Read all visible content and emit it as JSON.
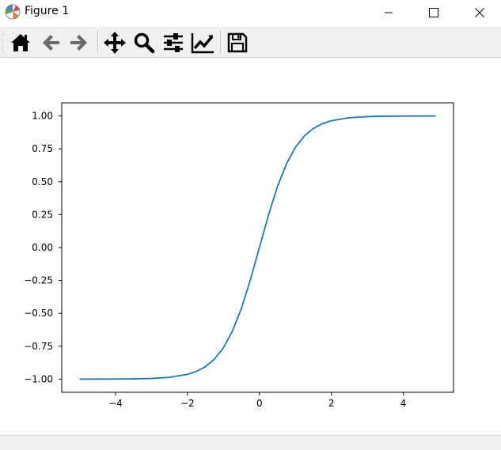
{
  "window": {
    "title": "Figure 1"
  },
  "toolbar": {
    "buttons": [
      {
        "name": "home",
        "icon": "home-icon"
      },
      {
        "name": "back",
        "icon": "arrow-left-icon"
      },
      {
        "name": "forward",
        "icon": "arrow-right-icon"
      },
      {
        "name": "pan",
        "icon": "move-icon"
      },
      {
        "name": "zoom",
        "icon": "magnifier-icon"
      },
      {
        "name": "configure-subplots",
        "icon": "sliders-icon"
      },
      {
        "name": "edit-axis",
        "icon": "line-chart-icon"
      },
      {
        "name": "save",
        "icon": "floppy-disk-icon"
      }
    ]
  },
  "colors": {
    "line": "#1f77b4",
    "toolbar_bg": "#f0f0f0"
  },
  "chart_data": {
    "type": "line",
    "title": "",
    "xlabel": "",
    "ylabel": "",
    "function": "tanh(x)",
    "x_range": [
      -5.0,
      4.9
    ],
    "xlim": [
      -5.495,
      5.395
    ],
    "ylim": [
      -1.09999,
      1.09999
    ],
    "xticks": [
      -4,
      -2,
      0,
      2,
      4
    ],
    "xtick_labels": [
      "−4",
      "−2",
      "0",
      "2",
      "4"
    ],
    "yticks": [
      -1.0,
      -0.75,
      -0.5,
      -0.25,
      0.0,
      0.25,
      0.5,
      0.75,
      1.0
    ],
    "ytick_labels": [
      "−1.00",
      "−0.75",
      "−0.50",
      "−0.25",
      "0.00",
      "0.25",
      "0.50",
      "0.75",
      "1.00"
    ],
    "series": [
      {
        "x": [
          -5.0,
          -4.5,
          -4.0,
          -3.5,
          -3.0,
          -2.5,
          -2.0,
          -1.75,
          -1.5,
          -1.25,
          -1.0,
          -0.75,
          -0.5,
          -0.25,
          0.0,
          0.25,
          0.5,
          0.75,
          1.0,
          1.25,
          1.5,
          1.75,
          2.0,
          2.5,
          3.0,
          3.5,
          4.0,
          4.5,
          4.9
        ],
        "y": [
          -0.9999,
          -0.9998,
          -0.9993,
          -0.9982,
          -0.9951,
          -0.9866,
          -0.964,
          -0.9414,
          -0.9051,
          -0.8483,
          -0.7616,
          -0.6351,
          -0.4621,
          -0.2449,
          0.0,
          0.2449,
          0.4621,
          0.6351,
          0.7616,
          0.8483,
          0.9051,
          0.9414,
          0.964,
          0.9866,
          0.9951,
          0.9982,
          0.9993,
          0.9998,
          0.9999
        ]
      }
    ],
    "grid": false,
    "legend": "none"
  }
}
